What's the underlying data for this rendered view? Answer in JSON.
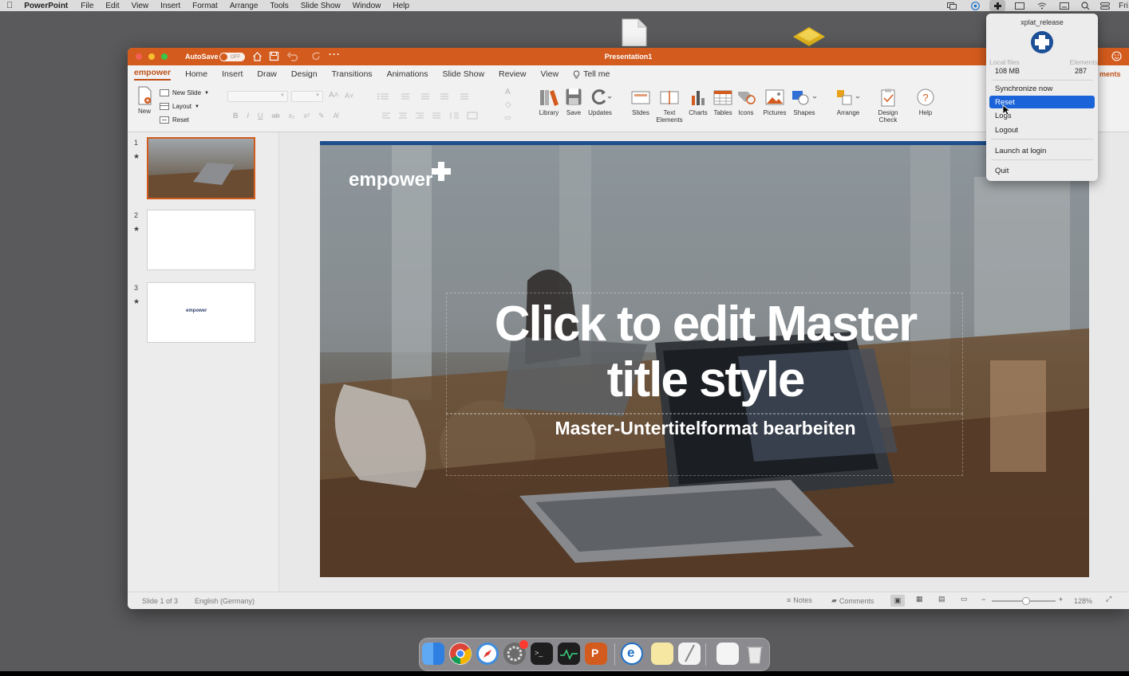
{
  "menubar": {
    "app_name": "PowerPoint",
    "items": [
      "File",
      "Edit",
      "View",
      "Insert",
      "Format",
      "Arrange",
      "Tools",
      "Slide Show",
      "Window",
      "Help"
    ],
    "clock_fragment": "Fri"
  },
  "window": {
    "title": "Presentation1",
    "autosave_label": "AutoSave",
    "autosave_state": "OFF",
    "accent": "#d35b1e"
  },
  "ribbon_tabs": [
    "empower",
    "Home",
    "Insert",
    "Draw",
    "Design",
    "Transitions",
    "Animations",
    "Slide Show",
    "Review",
    "View",
    "Tell me"
  ],
  "ribbon_tab_fragment": "ments",
  "ribbon": {
    "new": "New",
    "new_slide": "New Slide",
    "layout": "Layout",
    "reset": "Reset",
    "library": "Library",
    "save": "Save",
    "updates": "Updates",
    "slides": "Slides",
    "text_elements": "Text Elements",
    "charts": "Charts",
    "tables": "Tables",
    "icons": "Icons",
    "pictures": "Pictures",
    "shapes": "Shapes",
    "arrange": "Arrange",
    "design_check": "Design Check",
    "help": "Help"
  },
  "thumbnails": [
    {
      "number": "1"
    },
    {
      "number": "2"
    },
    {
      "number": "3",
      "logo": "empower"
    }
  ],
  "slide": {
    "logo": "empower",
    "title_line1": "Click to edit Master",
    "title_line2": "title style",
    "subtitle": "Master-Untertitelformat bearbeiten"
  },
  "statusbar": {
    "slide_info": "Slide 1 of 3",
    "language": "English (Germany)",
    "notes": "Notes",
    "comments": "Comments",
    "zoom": "128%"
  },
  "tray_menu": {
    "header": "xplat_release",
    "local_files_label": "Local files",
    "local_files_value": "108 MB",
    "elements_label": "Elements",
    "elements_value": "287",
    "items": [
      "Synchronize now",
      "Reset",
      "Logs",
      "Logout",
      "Launch at login",
      "Quit"
    ],
    "selected": "Reset",
    "highlight": "#1b63d8"
  }
}
